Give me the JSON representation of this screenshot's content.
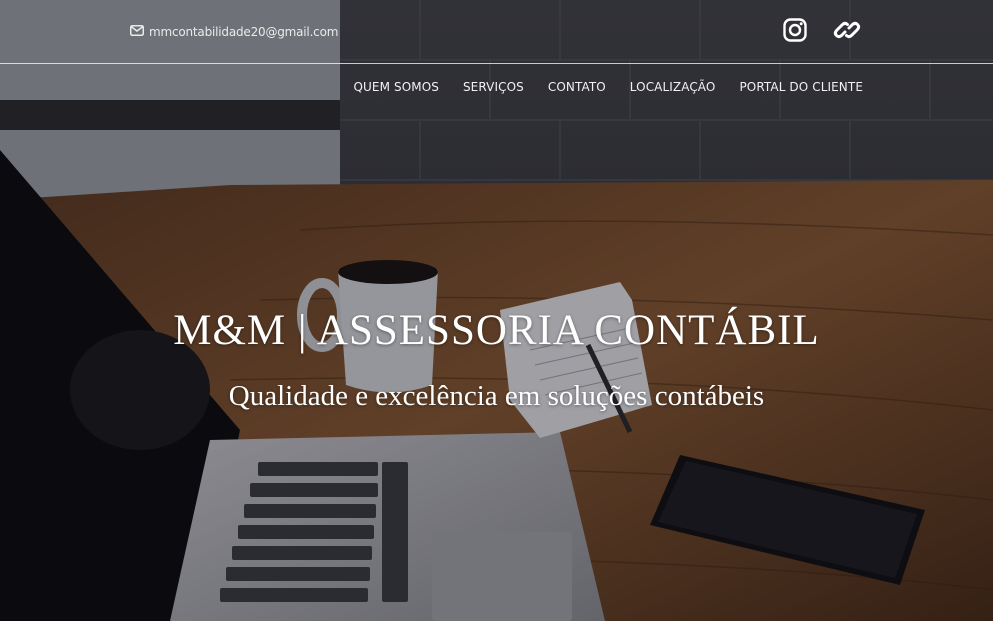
{
  "topbar": {
    "email": "mmcontabilidade20@gmail.com",
    "social_icons": [
      "instagram-icon",
      "link-icon"
    ]
  },
  "nav": {
    "items": [
      {
        "label": "QUEM SOMOS"
      },
      {
        "label": "SERVIÇOS"
      },
      {
        "label": "CONTATO"
      },
      {
        "label": "LOCALIZAÇÃO"
      },
      {
        "label": "PORTAL DO CLIENTE"
      }
    ]
  },
  "hero": {
    "title": "M&M | ASSESSORIA CONTÁBIL",
    "subtitle": "Qualidade e excelência em soluções contábeis"
  },
  "colors": {
    "text": "#ffffff",
    "overlay": "#0a0a0e"
  }
}
